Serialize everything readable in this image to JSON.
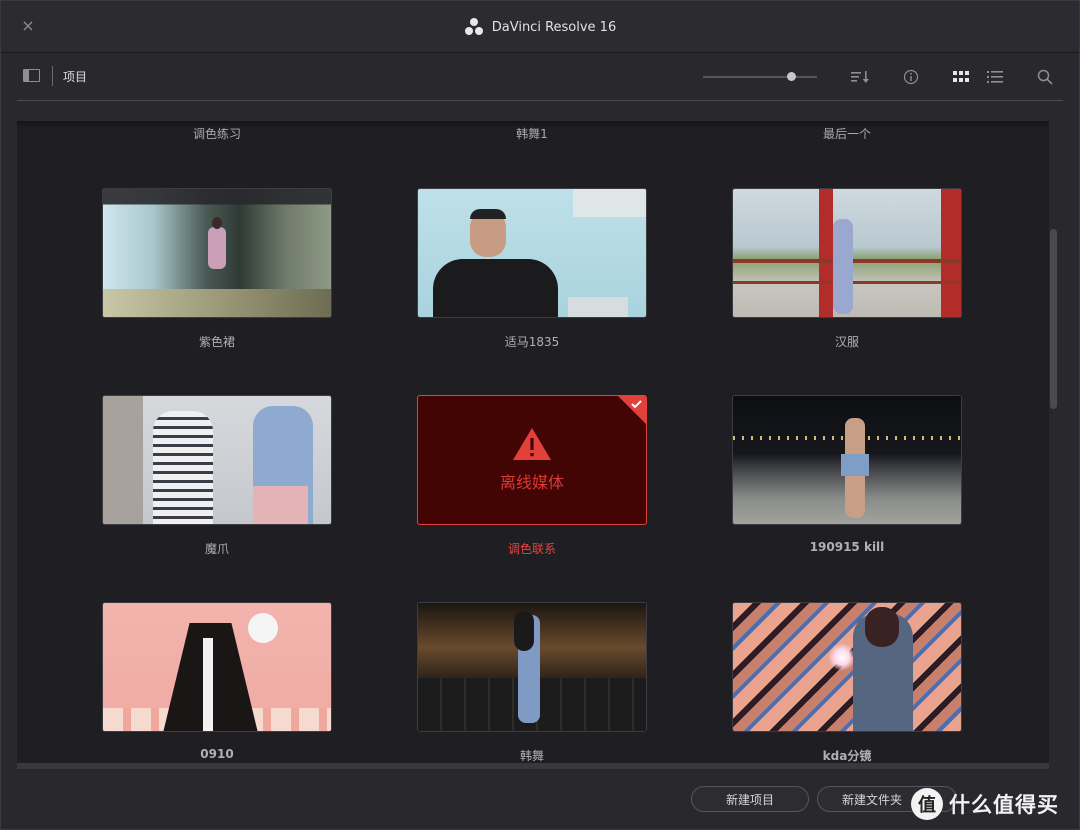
{
  "window": {
    "title": "DaVinci Resolve 16",
    "close_icon": "×"
  },
  "toolbar": {
    "breadcrumb": "项目",
    "zoom_level": 0.8,
    "icons": [
      "panel-toggle-icon",
      "sort-icon",
      "info-icon",
      "grid-view-icon",
      "list-view-icon",
      "search-icon"
    ]
  },
  "projects_partial": [
    "调色练习",
    "韩舞1",
    "最后一个"
  ],
  "projects": [
    {
      "name": "紫色裙",
      "status": "ok"
    },
    {
      "name": "适马1835",
      "status": "ok"
    },
    {
      "name": "汉服",
      "status": "ok"
    },
    {
      "name": "魔爪",
      "status": "ok"
    },
    {
      "name": "调色联系",
      "status": "offline",
      "selected": true,
      "offline_text": "离线媒体"
    },
    {
      "name": "190915 kill",
      "status": "ok"
    },
    {
      "name": "0910",
      "status": "ok"
    },
    {
      "name": "韩舞",
      "status": "ok"
    },
    {
      "name": "kda分镜",
      "status": "ok"
    }
  ],
  "buttons": {
    "new_project": "新建项目",
    "new_folder": "新建文件夹"
  },
  "watermark": {
    "logo": "值",
    "text": "什么值得买"
  },
  "colors": {
    "accent": "#e2403a",
    "offline_bg": "#430404",
    "background": "#1f1f23"
  }
}
